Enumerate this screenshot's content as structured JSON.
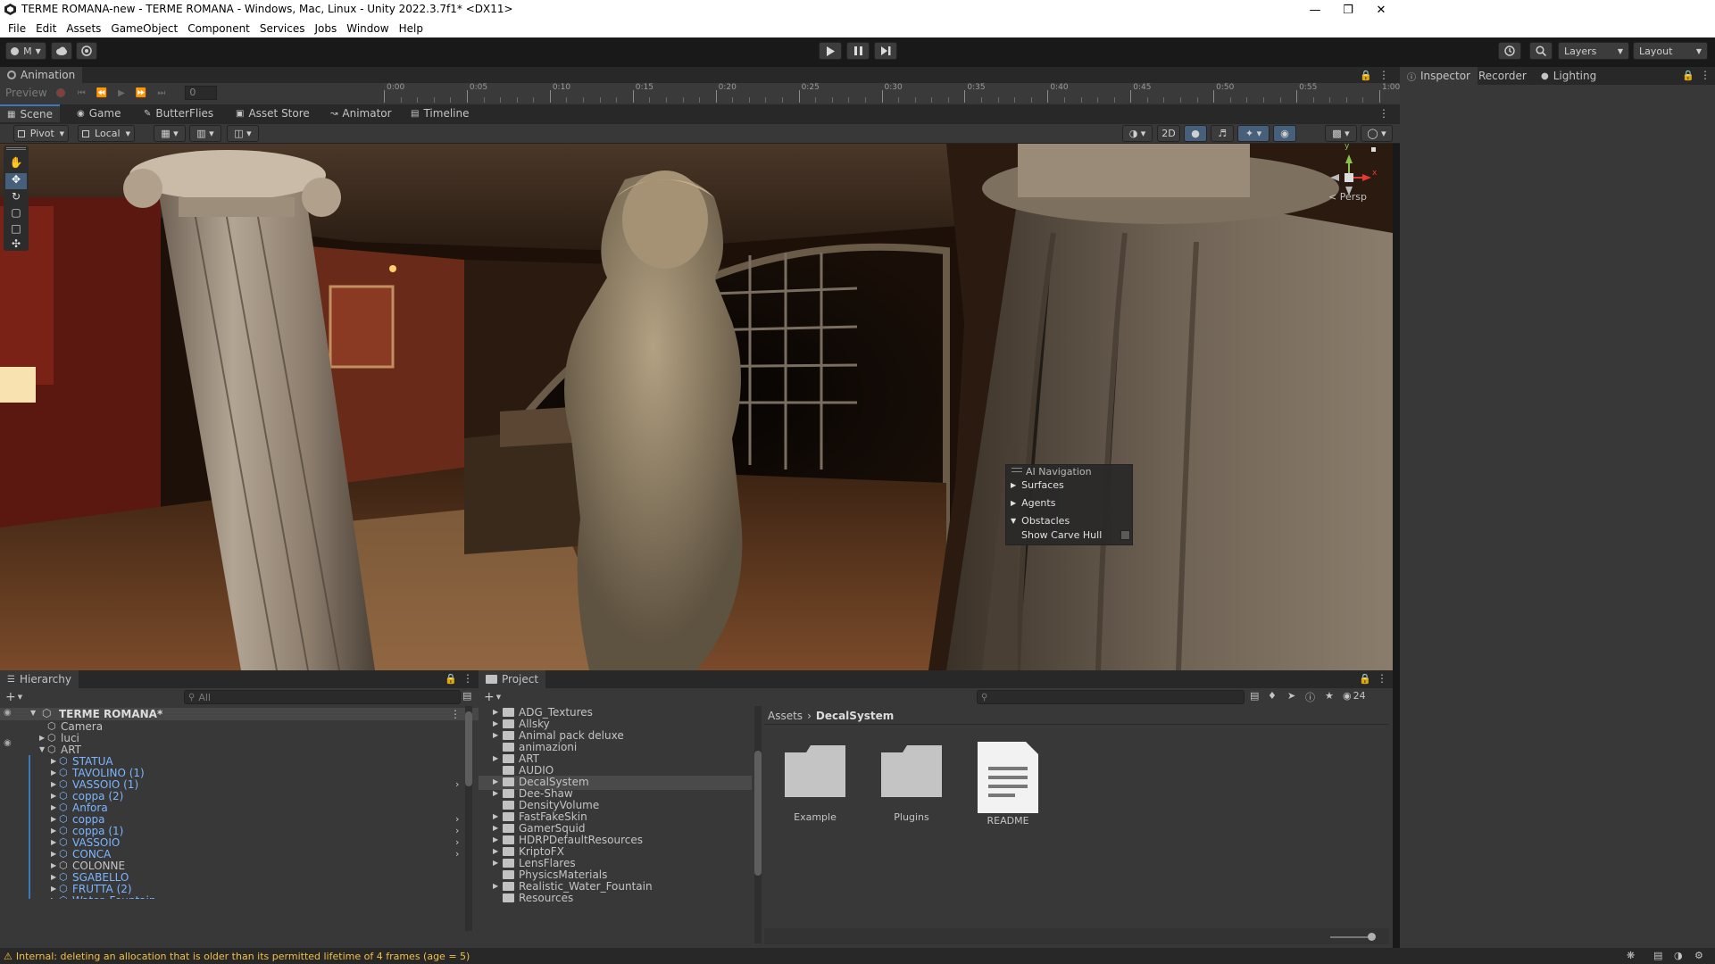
{
  "window": {
    "title": "TERME ROMANA-new - TERME ROMANA - Windows, Mac, Linux - Unity 2022.3.7f1* <DX11>"
  },
  "menu": [
    "File",
    "Edit",
    "Assets",
    "GameObject",
    "Component",
    "Services",
    "Jobs",
    "Window",
    "Help"
  ],
  "toolbar": {
    "account_label": "M",
    "layers_label": "Layers",
    "layout_label": "Layout"
  },
  "animation": {
    "tab_label": "Animation",
    "preview_label": "Preview",
    "frame_value": "0",
    "ruler": [
      "0:00",
      "0:05",
      "0:10",
      "0:15",
      "0:20",
      "0:25",
      "0:30",
      "0:35",
      "0:40",
      "0:45",
      "0:50",
      "0:55",
      "1:00"
    ]
  },
  "scene_tabs": [
    {
      "label": "Scene",
      "icon": "grid-icon"
    },
    {
      "label": "Game",
      "icon": "gamepad-icon"
    },
    {
      "label": "ButterFlies",
      "icon": "brush-icon"
    },
    {
      "label": "Asset Store",
      "icon": "bag-icon"
    },
    {
      "label": "Animator",
      "icon": "animator-icon"
    },
    {
      "label": "Timeline",
      "icon": "timeline-icon"
    }
  ],
  "scene_toolbar": {
    "pivot_label": "Pivot",
    "local_label": "Local",
    "mode_2d_label": "2D"
  },
  "viewport": {
    "persp_label": "< Persp",
    "gizmo_y": "y",
    "gizmo_x": "x",
    "ai_nav": {
      "title": "AI Navigation",
      "items": [
        "Surfaces",
        "Agents",
        "Obstacles"
      ],
      "option_label": "Show Carve Hull"
    }
  },
  "inspector_tabs": [
    "Inspector",
    "Recorder",
    "Lighting"
  ],
  "hierarchy": {
    "tab_label": "Hierarchy",
    "search_placeholder": "All",
    "scene_name": "TERME ROMANA*",
    "items": [
      {
        "label": "Camera",
        "depth": 1,
        "blue": false
      },
      {
        "label": "luci",
        "depth": 1,
        "blue": false
      },
      {
        "label": "ART",
        "depth": 1,
        "blue": false
      },
      {
        "label": "STATUA",
        "depth": 2,
        "blue": true
      },
      {
        "label": "TAVOLINO (1)",
        "depth": 2,
        "blue": true
      },
      {
        "label": "VASSOIO (1)",
        "depth": 2,
        "blue": true
      },
      {
        "label": "coppa (2)",
        "depth": 2,
        "blue": true
      },
      {
        "label": "Anfora",
        "depth": 2,
        "blue": true
      },
      {
        "label": "coppa",
        "depth": 2,
        "blue": true
      },
      {
        "label": "coppa (1)",
        "depth": 2,
        "blue": true
      },
      {
        "label": "VASSOIO",
        "depth": 2,
        "blue": true
      },
      {
        "label": "CONCA",
        "depth": 2,
        "blue": true
      },
      {
        "label": "COLONNE",
        "depth": 2,
        "blue": false
      },
      {
        "label": "SGABELLO",
        "depth": 2,
        "blue": true
      },
      {
        "label": "FRUTTA (2)",
        "depth": 2,
        "blue": true
      },
      {
        "label": "Water_Fountain",
        "depth": 2,
        "blue": true
      }
    ]
  },
  "project": {
    "tab_label": "Project",
    "hidden_count": "24",
    "folders": [
      "ADG_Textures",
      "Allsky",
      "Animal pack deluxe",
      "animazioni",
      "ART",
      "AUDIO",
      "DecalSystem",
      "Dee-Shaw",
      "DensityVolume",
      "FastFakeSkin",
      "GamerSquid",
      "HDRPDefaultResources",
      "KriptoFX",
      "LensFlares",
      "PhysicsMaterials",
      "Realistic_Water_Fountain",
      "Resources"
    ],
    "selected_folder": "DecalSystem",
    "breadcrumb": [
      "Assets",
      "DecalSystem"
    ],
    "assets": [
      {
        "label": "Example",
        "type": "folder"
      },
      {
        "label": "Plugins",
        "type": "folder"
      },
      {
        "label": "README",
        "type": "document"
      }
    ]
  },
  "status": {
    "message": "Internal: deleting an allocation that is older than its permitted lifetime of 4 frames (age = 5)"
  },
  "colors": {
    "accent": "#3a79bb",
    "prefab_blue": "#7cb6ff",
    "warning": "#f0c040"
  }
}
